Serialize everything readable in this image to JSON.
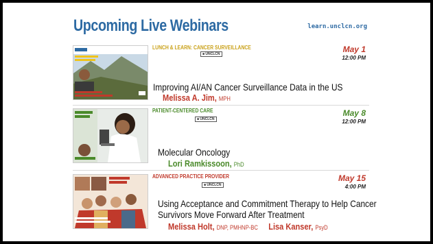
{
  "header": {
    "title": "Upcoming Live Webinars",
    "url": "learn.unclcn.org"
  },
  "webinars": [
    {
      "tag": "LUNCH & LEARN: CANCER SURVEILLANCE",
      "date": "May 1",
      "time": "12:00 PM",
      "title": "Improving AI/AN Cancer Surveillance Data in the US",
      "speakers": [
        {
          "name": "Melissa A. Jim,",
          "cred": "MPH"
        }
      ],
      "accent": "#c0392b"
    },
    {
      "tag": "PATIENT-CENTERED CARE",
      "date": "May 8",
      "time": "12:00 PM",
      "title": "Molecular Oncology",
      "speakers": [
        {
          "name": "Lori Ramkissoon,",
          "cred": "PhD"
        }
      ],
      "accent": "#4a8a2a"
    },
    {
      "tag": "ADVANCED PRACTICE PROVIDER",
      "date": "May 15",
      "time": "4:00 PM",
      "title_line1": "Using Acceptance and Commitment Therapy to Help Cancer",
      "title_line2": "Survivors Move Forward After Treatment",
      "speakers": [
        {
          "name": "Melissa Holt,",
          "cred": "DNP, PMHNP-BC"
        },
        {
          "name": "Lisa Kanser,",
          "cred": "PsyD"
        }
      ],
      "accent": "#c0392b"
    }
  ],
  "colors": {
    "title": "#2d6aa3",
    "red": "#c0392b",
    "green": "#4a8a2a"
  }
}
